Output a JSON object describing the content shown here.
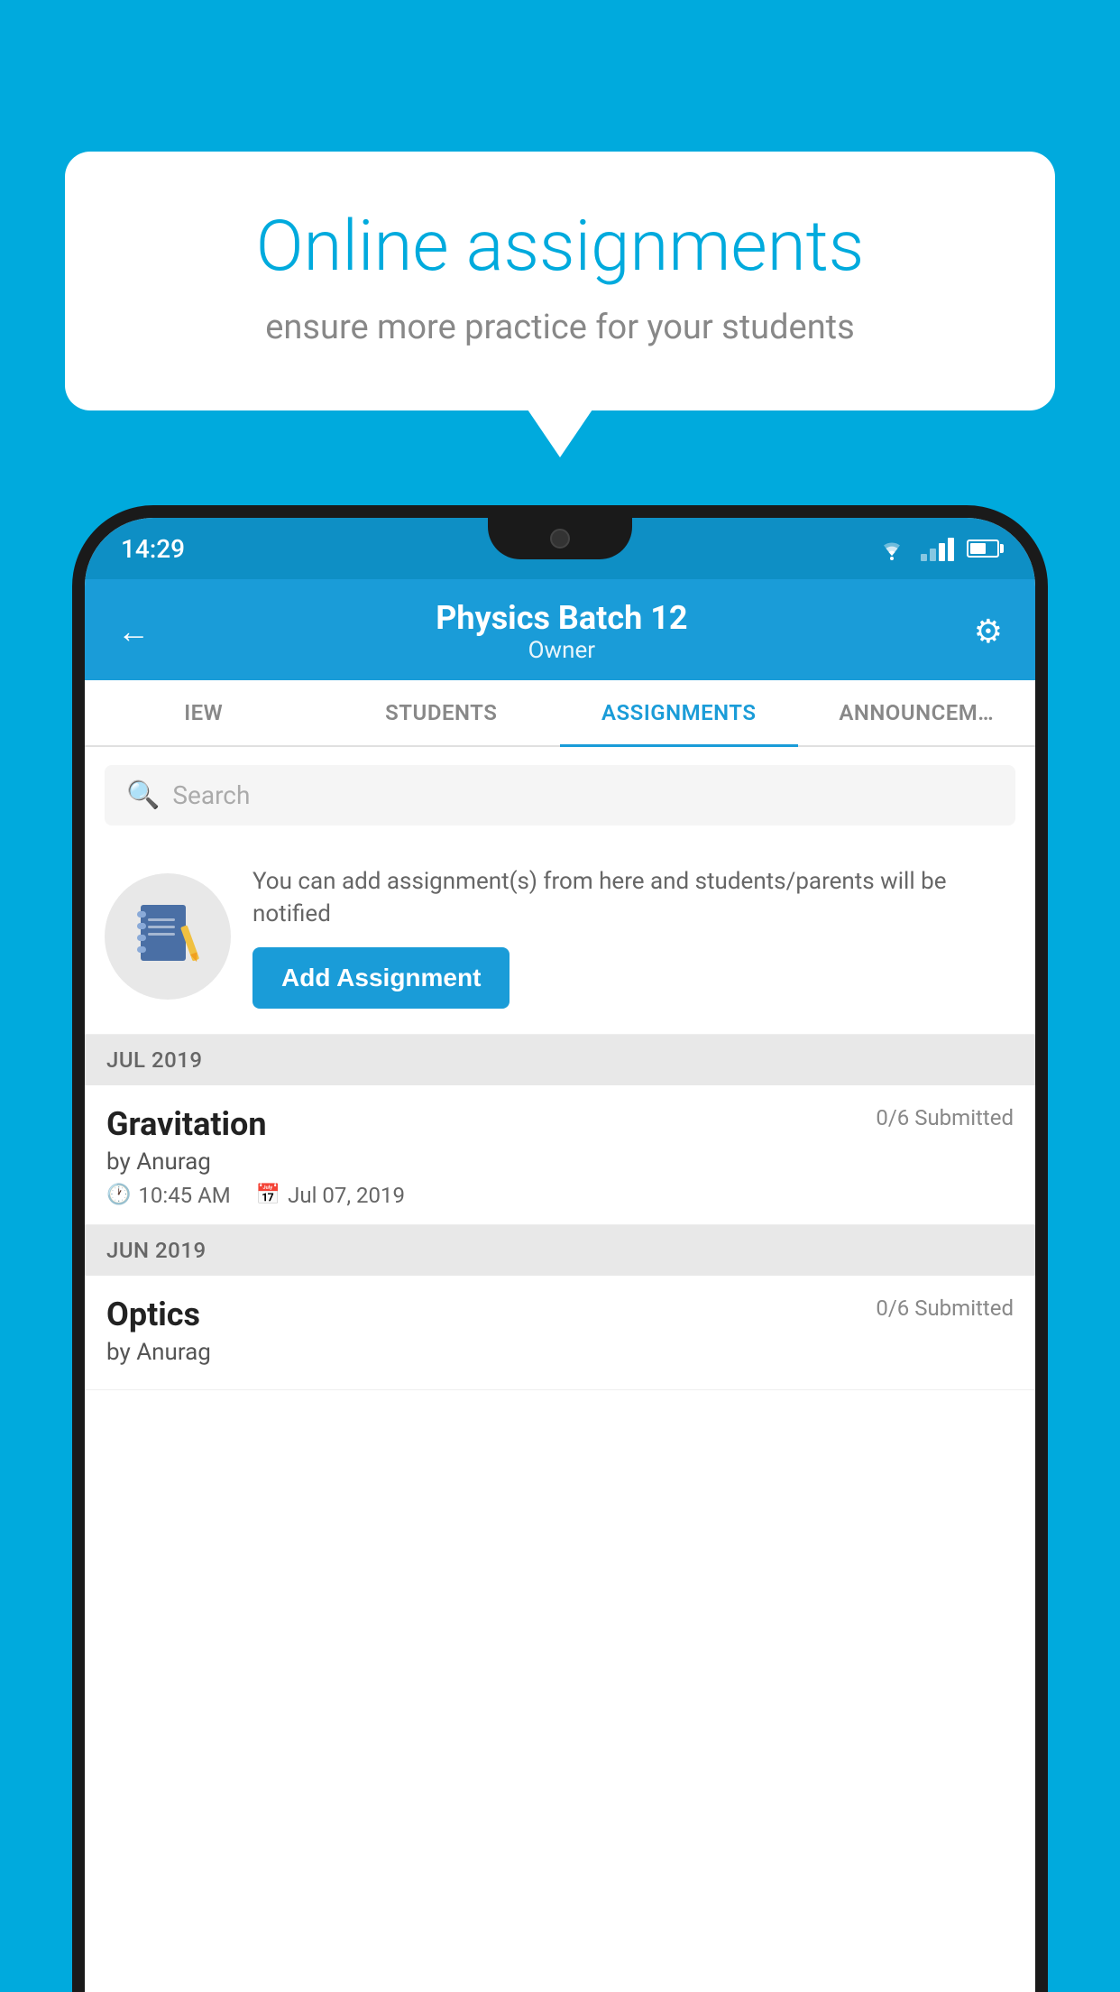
{
  "background_color": "#00AADD",
  "speech_bubble": {
    "title": "Online assignments",
    "subtitle": "ensure more practice for your students"
  },
  "status_bar": {
    "time": "14:29"
  },
  "header": {
    "title": "Physics Batch 12",
    "subtitle": "Owner",
    "back_label": "←",
    "settings_label": "⚙"
  },
  "tabs": [
    {
      "label": "IEW",
      "active": false
    },
    {
      "label": "STUDENTS",
      "active": false
    },
    {
      "label": "ASSIGNMENTS",
      "active": true
    },
    {
      "label": "ANNOUNCEM…",
      "active": false
    }
  ],
  "search": {
    "placeholder": "Search"
  },
  "add_assignment_prompt": {
    "description": "You can add assignment(s) from here and students/parents will be notified",
    "button_label": "Add Assignment"
  },
  "sections": [
    {
      "label": "JUL 2019",
      "assignments": [
        {
          "name": "Gravitation",
          "submitted": "0/6 Submitted",
          "author": "by Anurag",
          "time": "10:45 AM",
          "date": "Jul 07, 2019"
        }
      ]
    },
    {
      "label": "JUN 2019",
      "assignments": [
        {
          "name": "Optics",
          "submitted": "0/6 Submitted",
          "author": "by Anurag",
          "time": "",
          "date": ""
        }
      ]
    }
  ]
}
